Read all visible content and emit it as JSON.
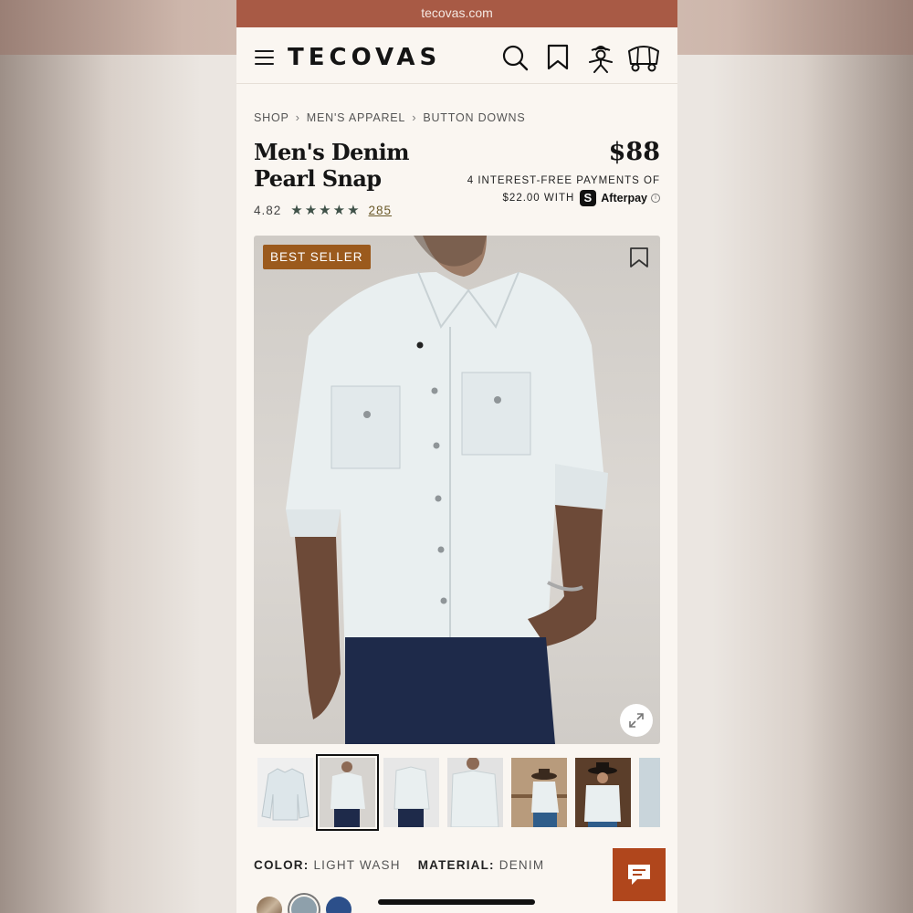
{
  "browser": {
    "url": "tecovas.com"
  },
  "header": {
    "brand": "TECOVAS",
    "icons": [
      "menu-icon",
      "search-icon",
      "bookmark-icon",
      "account-icon",
      "cart-icon"
    ]
  },
  "breadcrumb": [
    "SHOP",
    "MEN'S APPAREL",
    "BUTTON DOWNS"
  ],
  "product": {
    "title": "Men's Denim Pearl Snap",
    "price": "$88",
    "rating": "4.82",
    "stars": "★★★★★",
    "review_count": "285",
    "payment_line1": "4 INTEREST-FREE PAYMENTS OF",
    "payment_amount": "$22.00 WITH",
    "afterpay_badge": "S",
    "afterpay_label": "Afterpay",
    "info_icon": "i",
    "badge": "BEST SELLER"
  },
  "attributes": {
    "color_label": "COLOR:",
    "color_value": "LIGHT WASH",
    "material_label": "MATERIAL:",
    "material_value": "DENIM"
  },
  "colors": {
    "accent": "#a85a45",
    "badge": "#9b5a1d",
    "chat": "#b0461c",
    "background": "#faf6f1"
  }
}
